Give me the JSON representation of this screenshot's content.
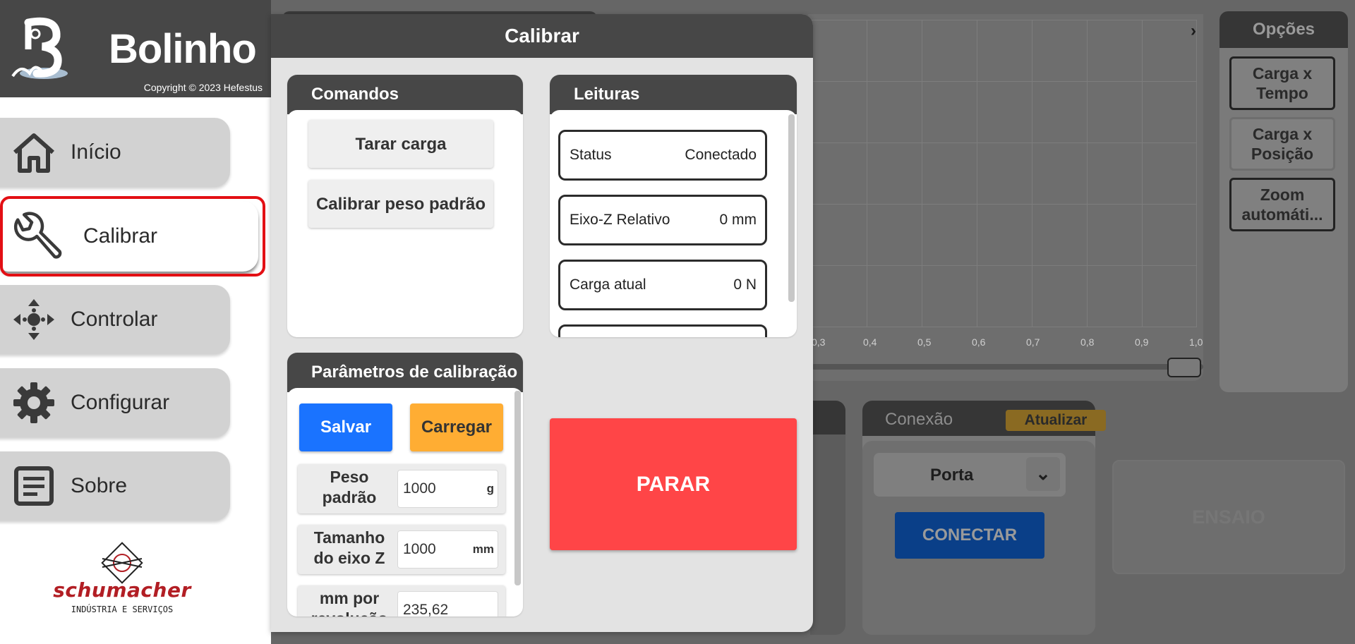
{
  "sidebar": {
    "app_name": "Bolinho",
    "copyright": "Copyright © 2023 Hefestus",
    "items": [
      {
        "label": "Início",
        "icon": "home-icon"
      },
      {
        "label": "Calibrar",
        "icon": "wrench-icon"
      },
      {
        "label": "Controlar",
        "icon": "move-arrows-icon"
      },
      {
        "label": "Configurar",
        "icon": "gear-icon"
      },
      {
        "label": "Sobre",
        "icon": "document-icon"
      }
    ],
    "active_item": "Calibrar",
    "brand": {
      "name": "schumacher",
      "tagline": "INDÚSTRIA E SERVIÇOS"
    }
  },
  "modal": {
    "title": "Calibrar",
    "commands": {
      "title": "Comandos",
      "buttons": [
        "Tarar carga",
        "Calibrar peso padrão"
      ]
    },
    "readings": {
      "title": "Leituras",
      "items": [
        {
          "label": "Status",
          "value": "Conectado"
        },
        {
          "label": "Eixo-Z Relativo",
          "value": "0 mm"
        },
        {
          "label": "Carga atual",
          "value": "0 N"
        }
      ]
    },
    "params": {
      "title": "Parâmetros de calibração",
      "save_label": "Salvar",
      "load_label": "Carregar",
      "rows": [
        {
          "label": "Peso padrão",
          "value": "1000",
          "unit": "g"
        },
        {
          "label": "Tamanho do eixo Z",
          "value": "1000",
          "unit": "mm"
        },
        {
          "label": "mm por revolução",
          "value": "235,62",
          "unit": ""
        }
      ]
    },
    "stop_label": "PARAR"
  },
  "background": {
    "chart_ticks": [
      "0,3",
      "0,4",
      "0,5",
      "0,6",
      "0,7",
      "0,8",
      "0,9",
      "1,0"
    ],
    "options_title": "Opções",
    "options_buttons": [
      "Carga x Tempo",
      "Carga x Posição",
      "Zoom automáti..."
    ],
    "connection_title": "Conexão",
    "refresh_label": "Atualizar",
    "port_label": "Porta",
    "connect_label": "CONECTAR",
    "test_label": "ENSAIO"
  },
  "colors": {
    "header_dark": "#474747",
    "active_highlight": "#e30f14",
    "save_blue": "#1a73ff",
    "load_orange": "#ffad33",
    "stop_red": "#ff4547"
  }
}
